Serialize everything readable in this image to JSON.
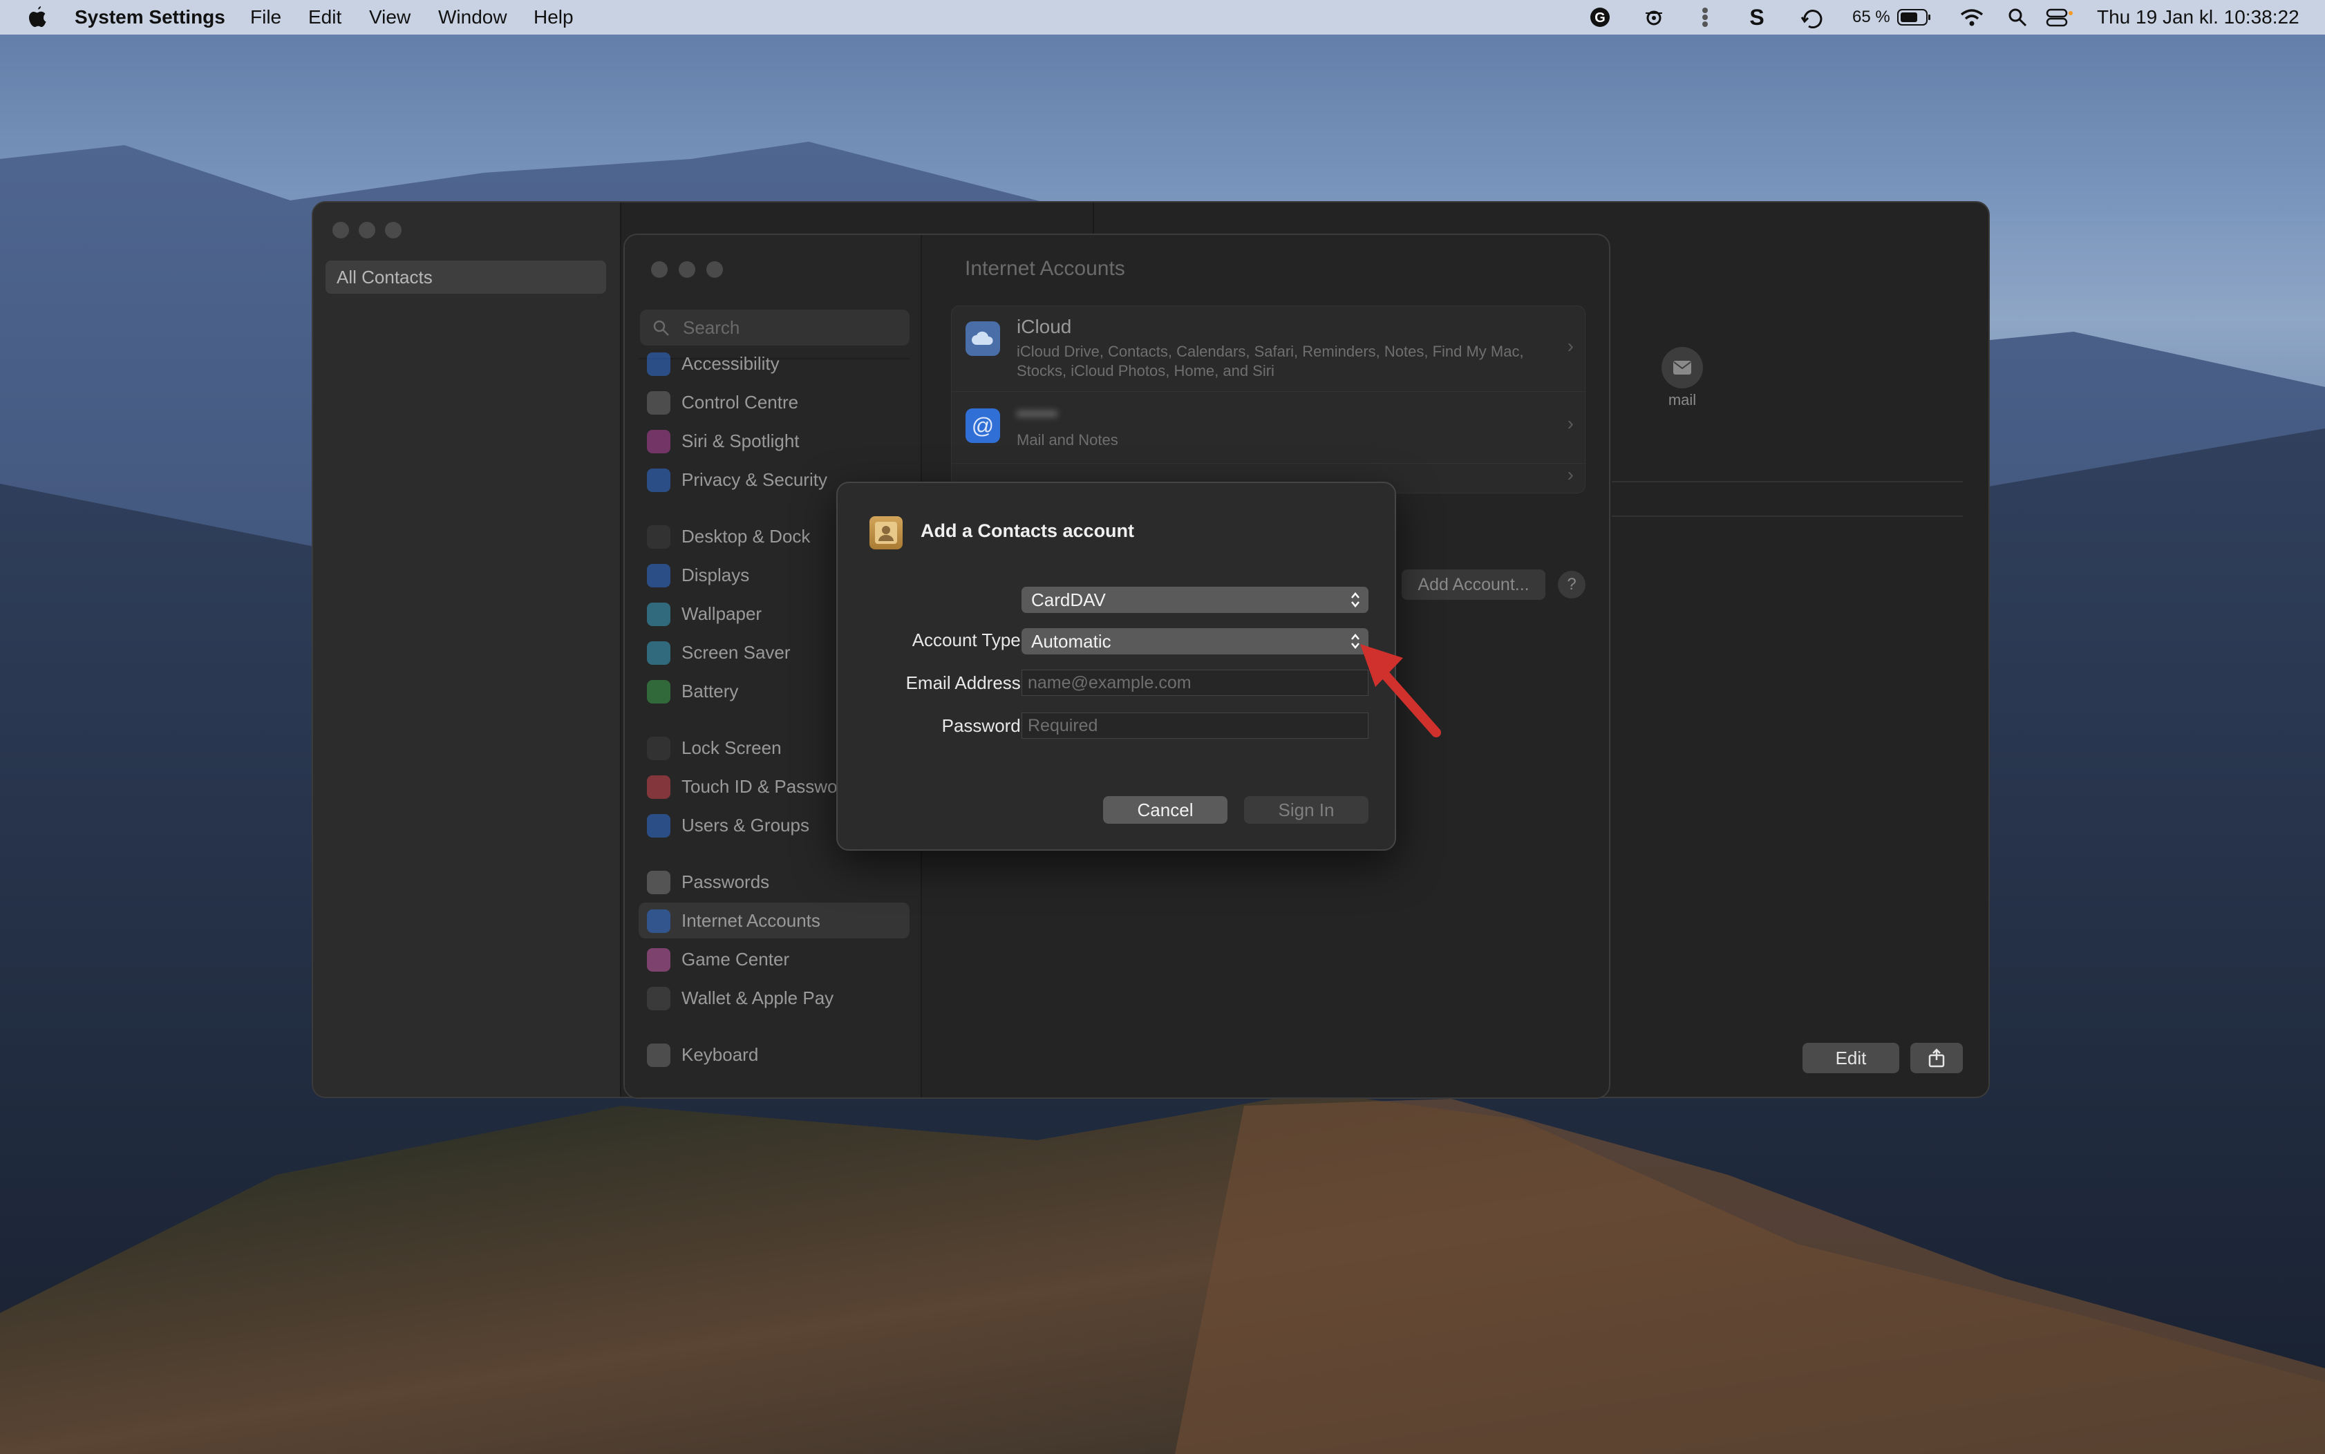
{
  "menubar": {
    "app_name": "System Settings",
    "menus": [
      "File",
      "Edit",
      "View",
      "Window",
      "Help"
    ],
    "battery_percent": "65 %",
    "clock": "Thu 19 Jan kl. 10:38:22"
  },
  "contacts_window": {
    "sidebar_selected": "All Contacts",
    "mail_label": "mail",
    "edit_label": "Edit"
  },
  "settings_window": {
    "search_placeholder": "Search",
    "sidebar": [
      {
        "label": "Accessibility",
        "icon": "accessibility-icon",
        "color": "#2f6fd6"
      },
      {
        "label": "Control Centre",
        "icon": "control-centre-icon",
        "color": "#6e6e6e"
      },
      {
        "label": "Siri & Spotlight",
        "icon": "siri-icon",
        "color": "#b0429b"
      },
      {
        "label": "Privacy & Security",
        "icon": "hand-icon",
        "color": "#2f6fd6"
      },
      {
        "label": "Desktop & Dock",
        "icon": "desktop-icon",
        "color": "#3c3c3c"
      },
      {
        "label": "Displays",
        "icon": "displays-icon",
        "color": "#2f6fd6"
      },
      {
        "label": "Wallpaper",
        "icon": "wallpaper-icon",
        "color": "#3aa0c4"
      },
      {
        "label": "Screen Saver",
        "icon": "screen-saver-icon",
        "color": "#3aa0c4"
      },
      {
        "label": "Battery",
        "icon": "battery-icon",
        "color": "#3aa04a"
      },
      {
        "label": "Lock Screen",
        "icon": "lock-icon",
        "color": "#3c3c3c"
      },
      {
        "label": "Touch ID & Passwo",
        "icon": "fingerprint-icon",
        "color": "#d0454f"
      },
      {
        "label": "Users & Groups",
        "icon": "users-icon",
        "color": "#2f6fd6"
      },
      {
        "label": "Passwords",
        "icon": "key-icon",
        "color": "#7a7a7a"
      },
      {
        "label": "Internet Accounts",
        "icon": "at-icon",
        "color": "#2f6fd6"
      },
      {
        "label": "Game Center",
        "icon": "game-center-icon",
        "color": "#c45aa8"
      },
      {
        "label": "Wallet & Apple Pay",
        "icon": "wallet-icon",
        "color": "#4a4a4a"
      },
      {
        "label": "Keyboard",
        "icon": "keyboard-icon",
        "color": "#6e6e6e"
      }
    ],
    "content_title": "Internet Accounts",
    "accounts": [
      {
        "title": "iCloud",
        "subtitle": "iCloud Drive, Contacts, Calendars, Safari, Reminders, Notes, Find My Mac, Stocks, iCloud Photos, Home, and Siri"
      },
      {
        "title": "",
        "subtitle": "Mail and Notes"
      }
    ],
    "add_account_label": "Add Account...",
    "help_label": "?"
  },
  "dialog": {
    "title": "Add a Contacts account",
    "account_kind": "CardDAV",
    "account_type_label": "Account Type:",
    "account_type_value": "Automatic",
    "email_label": "Email Address:",
    "email_placeholder": "name@example.com",
    "password_label": "Password:",
    "password_placeholder": "Required",
    "cancel_label": "Cancel",
    "signin_label": "Sign In"
  },
  "annotation": {
    "arrow_color": "#d0312d"
  }
}
